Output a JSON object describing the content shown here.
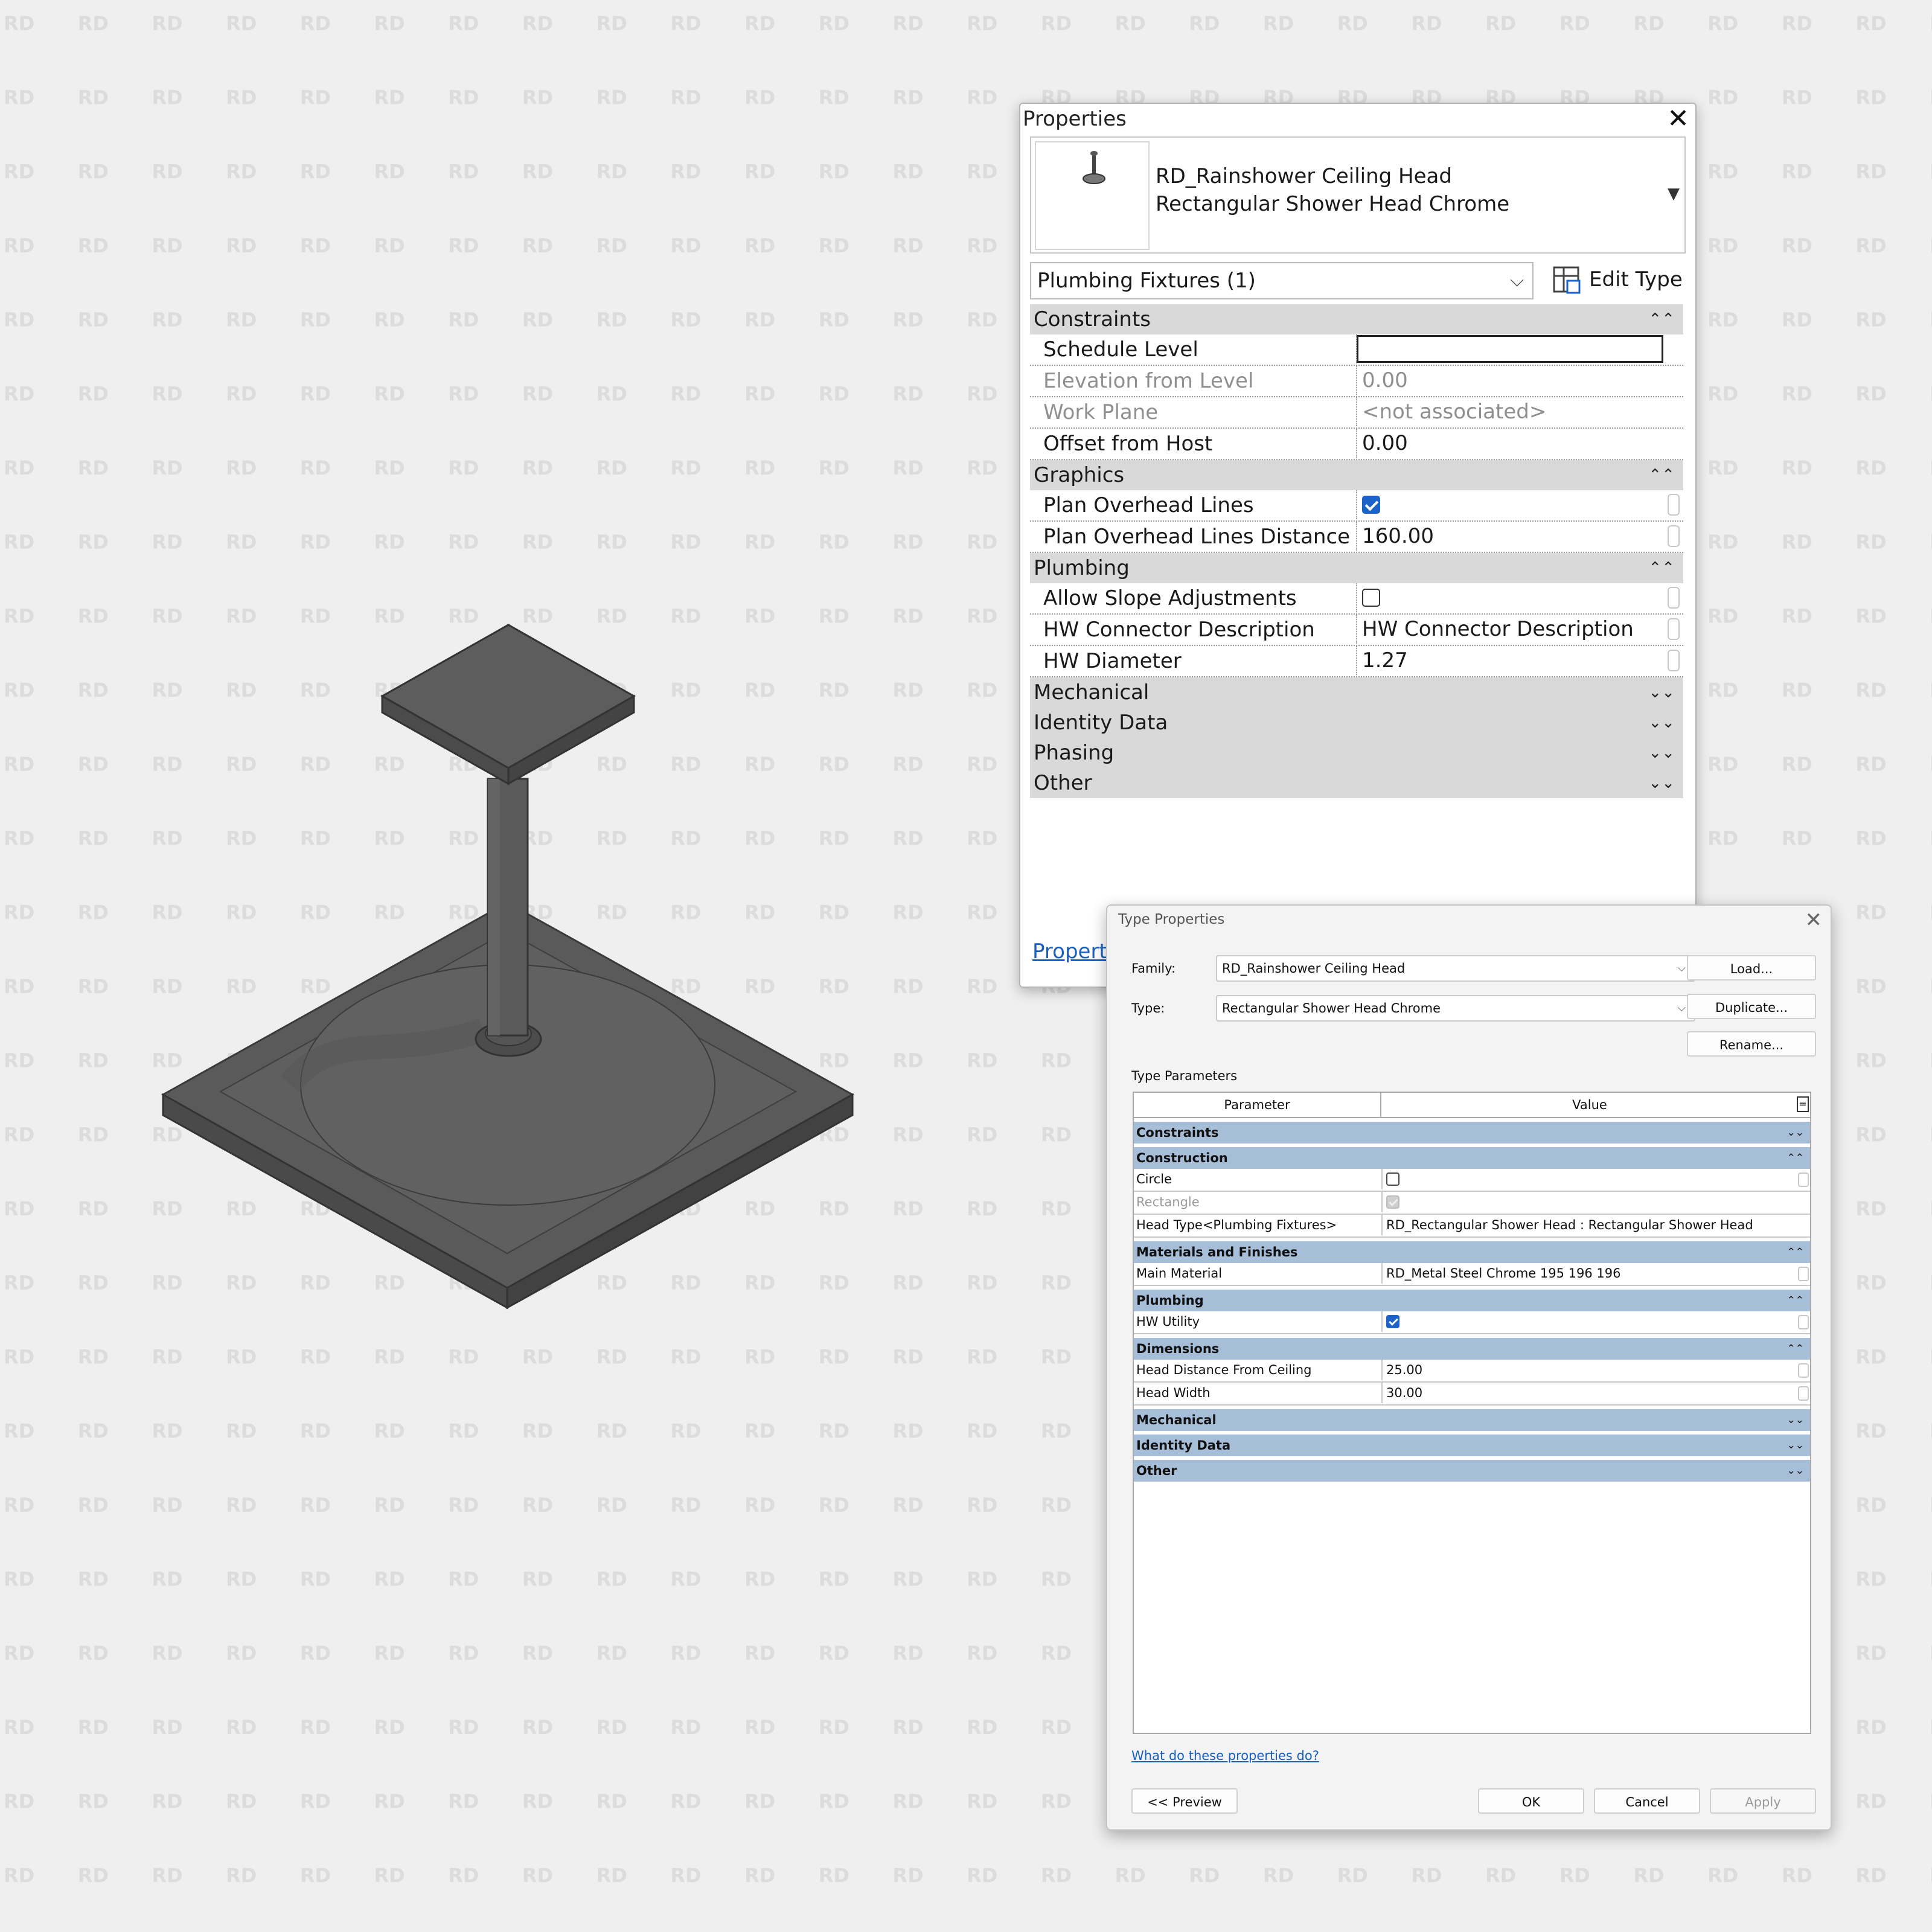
{
  "watermark_text": "RD",
  "properties": {
    "title": "Properties",
    "type_line1": "RD_Rainshower Ceiling Head",
    "type_line2": "Rectangular Shower Head Chrome",
    "category_select": "Plumbing Fixtures (1)",
    "edit_type_label": "Edit Type",
    "help_link": "Properti",
    "groups": {
      "constraints": "Constraints",
      "graphics": "Graphics",
      "plumbing": "Plumbing",
      "mechanical": "Mechanical",
      "identity": "Identity Data",
      "phasing": "Phasing",
      "other": "Other"
    },
    "rows": {
      "schedule_level": {
        "name": "Schedule Level",
        "value": ""
      },
      "elevation": {
        "name": "Elevation from Level",
        "value": "0.00"
      },
      "work_plane": {
        "name": "Work Plane",
        "value": "<not associated>"
      },
      "offset": {
        "name": "Offset from Host",
        "value": "0.00"
      },
      "plan_overhead": {
        "name": "Plan Overhead Lines",
        "checked": true
      },
      "plan_overhead_dist": {
        "name": "Plan Overhead Lines Distance",
        "value": "160.00"
      },
      "allow_slope": {
        "name": "Allow Slope Adjustments",
        "checked": false
      },
      "hw_conn_desc": {
        "name": "HW Connector Description",
        "value": "HW Connector Description"
      },
      "hw_diameter": {
        "name": "HW Diameter",
        "value": "1.27"
      }
    }
  },
  "type_properties": {
    "title": "Type Properties",
    "family_label": "Family:",
    "family_value": "RD_Rainshower Ceiling Head",
    "type_label": "Type:",
    "type_value": "Rectangular Shower Head Chrome",
    "load_btn": "Load...",
    "duplicate_btn": "Duplicate...",
    "rename_btn": "Rename...",
    "section_label": "Type Parameters",
    "col_parameter": "Parameter",
    "col_value": "Value",
    "col_extra": "=",
    "groups": {
      "constraints": "Constraints",
      "construction": "Construction",
      "materials": "Materials and Finishes",
      "plumbing": "Plumbing",
      "dimensions": "Dimensions",
      "mechanical": "Mechanical",
      "identity": "Identity Data",
      "other": "Other"
    },
    "rows": {
      "circle": {
        "name": "Circle",
        "checked": false
      },
      "rectangle": {
        "name": "Rectangle",
        "checked": true
      },
      "head_type": {
        "name": "Head Type<Plumbing Fixtures>",
        "value": "RD_Rectangular Shower Head : Rectangular Shower Head"
      },
      "main_material": {
        "name": "Main Material",
        "value": "RD_Metal Steel Chrome 195 196 196"
      },
      "hw_utility": {
        "name": "HW Utility",
        "checked": true
      },
      "head_distance": {
        "name": "Head Distance From Ceiling",
        "value": "25.00"
      },
      "head_width": {
        "name": "Head Width",
        "value": "30.00"
      }
    },
    "help_link": "What do these properties do?",
    "preview_btn": "<< Preview",
    "ok_btn": "OK",
    "cancel_btn": "Cancel",
    "apply_btn": "Apply"
  },
  "colors": {
    "group_header_props": "#d9d9d9",
    "group_header_type": "#a7bed8",
    "checkbox_blue": "#1c63c9",
    "model_gray": "#5e5e5e",
    "link_blue": "#1a5fbf"
  }
}
